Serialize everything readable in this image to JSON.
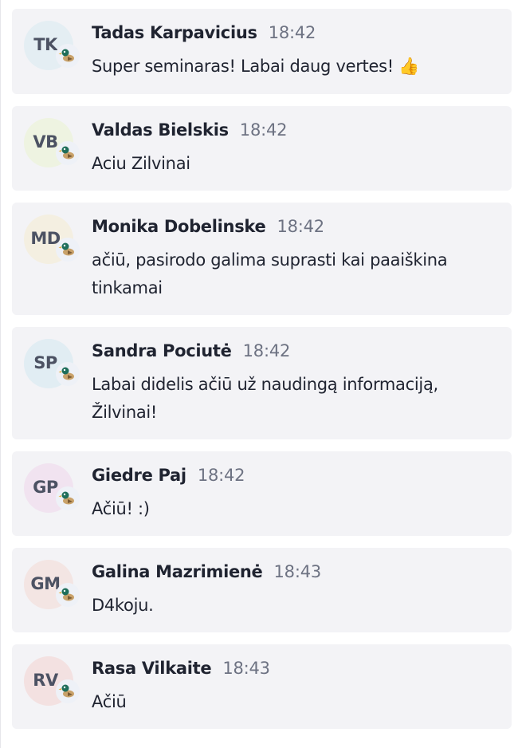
{
  "messages": [
    {
      "initials": "TK",
      "name": "Tadas Karpavicius",
      "time": "18:42",
      "text": "Super seminaras! Labai daug vertes! 👍",
      "avatar_color": "#e4eef3"
    },
    {
      "initials": "VB",
      "name": "Valdas Bielskis",
      "time": "18:42",
      "text": "Aciu Zilvinai",
      "avatar_color": "#eef3e1"
    },
    {
      "initials": "MD",
      "name": "Monika Dobelinske",
      "time": "18:42",
      "text": "ačiū, pasirodo galima suprasti kai paaiškina tinkamai",
      "avatar_color": "#f4efe1"
    },
    {
      "initials": "SP",
      "name": "Sandra Pociutė",
      "time": "18:42",
      "text": "Labai didelis ačiū už naudingą informaciją, Žilvinai!",
      "avatar_color": "#e1edf3"
    },
    {
      "initials": "GP",
      "name": "Giedre Paj",
      "time": "18:42",
      "text": "Ačiū! :)",
      "avatar_color": "#f1e3f0"
    },
    {
      "initials": "GM",
      "name": "Galina Mazrimienė",
      "time": "18:43",
      "text": "D4koju.",
      "avatar_color": "#f3e5e3"
    },
    {
      "initials": "RV",
      "name": "Rasa Vilkaite",
      "time": "18:43",
      "text": "Ačiū",
      "avatar_color": "#f3e1e1"
    }
  ],
  "badge_icon": "guest-duck-icon"
}
